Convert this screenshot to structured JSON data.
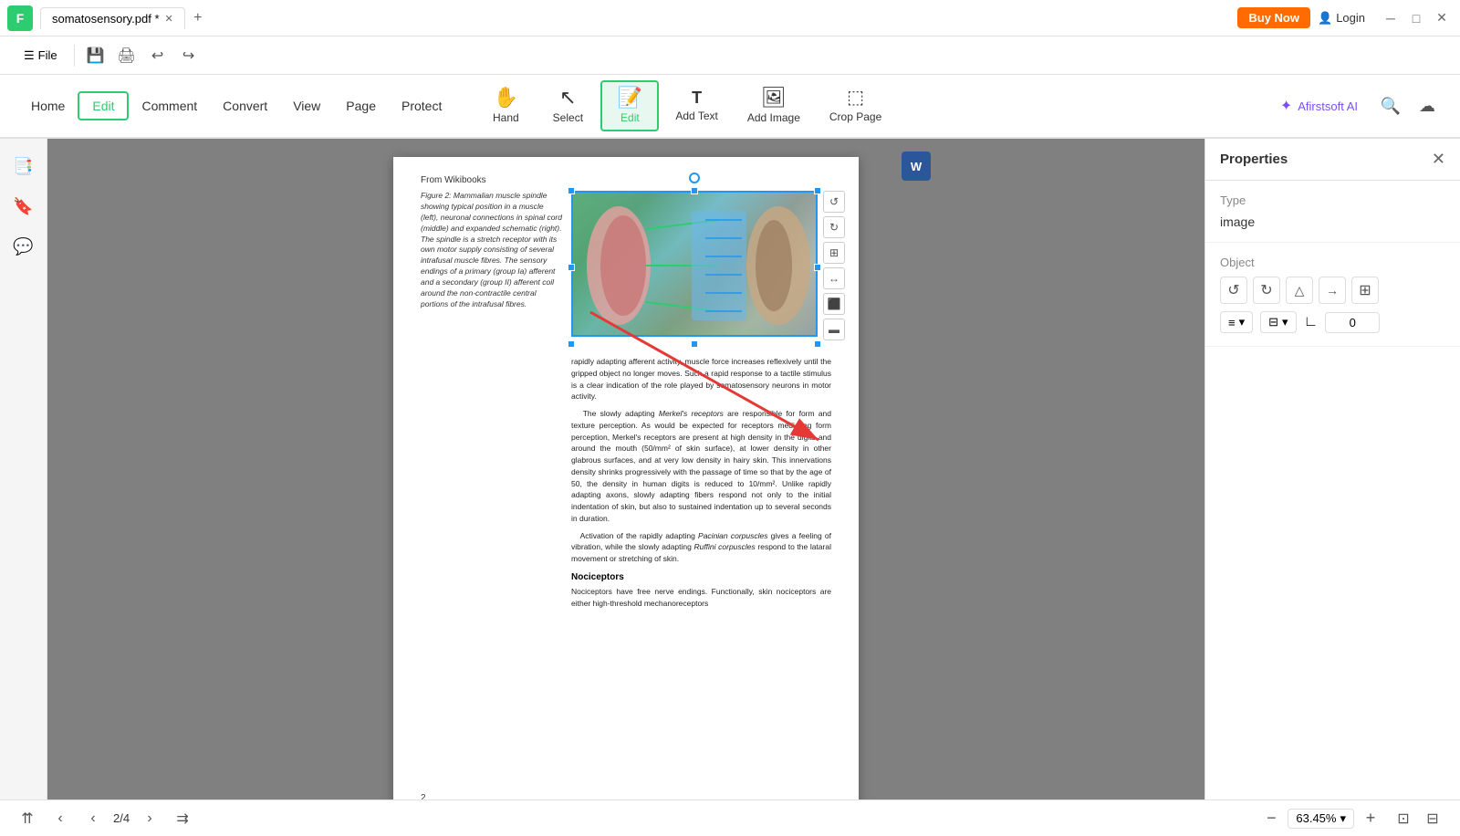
{
  "titleBar": {
    "appLogo": "F",
    "tab": {
      "label": "somatosensory.pdf *",
      "modified": true
    },
    "addTab": "+",
    "buyNow": "Buy Now",
    "login": "Login",
    "winControls": {
      "minimize": "─",
      "maximize": "□",
      "close": "✕"
    }
  },
  "menuBar": {
    "fileLabel": "File",
    "icons": [
      "💾",
      "🖨",
      "↩",
      "↪"
    ]
  },
  "toolbar": {
    "navItems": [
      {
        "label": "Home",
        "active": false
      },
      {
        "label": "Edit",
        "active": true
      },
      {
        "label": "Comment",
        "active": false
      },
      {
        "label": "Convert",
        "active": false
      },
      {
        "label": "View",
        "active": false
      },
      {
        "label": "Page",
        "active": false
      },
      {
        "label": "Protect",
        "active": false
      }
    ],
    "tools": [
      {
        "label": "Hand",
        "icon": "✋",
        "active": false
      },
      {
        "label": "Select",
        "icon": "↖",
        "active": false
      },
      {
        "label": "Edit",
        "icon": "📝",
        "active": true
      },
      {
        "label": "Add Text",
        "icon": "T",
        "active": false
      },
      {
        "label": "Add Image",
        "icon": "🖼",
        "active": false
      },
      {
        "label": "Crop Page",
        "icon": "⬚",
        "active": false
      }
    ],
    "ai": {
      "label": "Afirstsoft AI",
      "icon": "✦"
    },
    "searchIcon": "🔍",
    "uploadIcon": "☁"
  },
  "leftSidebar": {
    "icons": [
      "📑",
      "🔖",
      "💬"
    ]
  },
  "pdfPage": {
    "fromWikibooks": "From Wikibooks",
    "figCaption": "Figure 2: Mammalian muscle spindle showing typical position in a muscle (left), neuronal connections in spinal cord (middle) and expanded schematic (right). The spindle is a stretch receptor with its own motor supply consisting of several intrafusal muscle fibres. The sensory endings of a primary (group Ia) afferent and a secondary (group II) afferent coil around the non-contractile central portions of the intrafusal fibres.",
    "mainText": [
      "rapidly adapting afferent activity, muscle force increases reflexively until the gripped object no longer moves. Such a rapid response to a tactile stimulus is a clear indication of the role played by somatosensory neurons in motor activity.",
      "The slowly adapting Merkel's receptors are responsible for form and texture perception. As would be expected for receptors mediating form perception, Merkel's receptors are present at high density in the digits and around the mouth (50/mm² of skin surface), at lower density in other glabrous surfaces, and at very low density in hairy skin. This innervations density shrinks progressively with the passage of time so that by the age of 50, the density in human digits is reduced to 10/mm². Unlike rapidly adapting axons, slowly adapting fibers respond not only to the initial indentation of skin, but also to sustained indentation up to several seconds in duration.",
      "Activation of the rapidly adapting Pacinian corpuscles gives a feeling of vibration, while the slowly adapting Ruffini corpuscles respond to the lataral movement or stretching of skin."
    ],
    "nociceptors": {
      "heading": "Nociceptors",
      "text": "Nociceptors have free nerve endings. Functionally, skin nociceptors are either high-threshold mechanoreceptors"
    },
    "pageNumber": "2"
  },
  "properties": {
    "title": "Properties",
    "closeIcon": "✕",
    "type": {
      "label": "Type",
      "value": "image"
    },
    "object": {
      "label": "Object",
      "tools": [
        "↺",
        "↻",
        "△",
        "→",
        "⊞"
      ],
      "alignIcon": "≡",
      "distributeIcon": "⊟",
      "angleIcon": "∟",
      "angleValue": "0"
    }
  },
  "statusBar": {
    "firstPage": "⇈",
    "prevPage": "‹",
    "nextPage": "›",
    "lastPage": "⇉",
    "pageIndicator": "2/4",
    "zoomOut": "−",
    "zoomIn": "+",
    "zoomValue": "63.45%",
    "fitPage": "⊡",
    "fitWidth": "⊟"
  }
}
